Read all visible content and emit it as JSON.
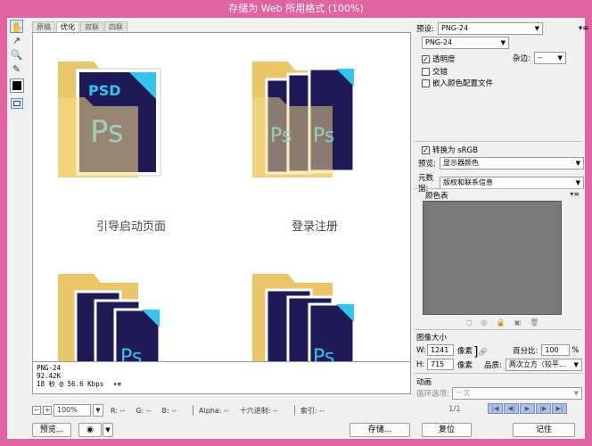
{
  "window": {
    "title": "存储为 Web 所用格式 (100%)"
  },
  "tabs": [
    {
      "label": "原稿"
    },
    {
      "label": "优化"
    },
    {
      "label": "双联"
    },
    {
      "label": "四联"
    }
  ],
  "canvas": {
    "captions": [
      "引导启动页面",
      "登录注册"
    ],
    "folder_badges": [
      "PSD",
      "Ps"
    ]
  },
  "info": {
    "format": "PNG-24",
    "size": "92.42K",
    "time": "18 秒 @ 56.6 Kbps",
    "menu_glyph": "▾≡"
  },
  "status": {
    "zoom": "100%",
    "r": "R: --",
    "g": "G: --",
    "b": "B: --",
    "alpha": "Alpha: --",
    "hex": "十六进制: --",
    "index": "索引: --"
  },
  "bottom_buttons": {
    "preview": "预览...",
    "save": "存储...",
    "reset": "复位",
    "remember": "记住"
  },
  "right": {
    "preset_label": "预设:",
    "preset_value": "PNG-24",
    "format_value": "PNG-24",
    "transparency": "透明度",
    "matte_label": "杂边:",
    "matte_value": "--",
    "interlaced": "交错",
    "embed_profile": "嵌入颜色配置文件",
    "convert_srgb": "转换为 sRGB",
    "preview_label": "预览:",
    "preview_value": "显示器颜色",
    "metadata_label": "元数据:",
    "metadata_value": "版权和联系信息",
    "color_table": "颜色表",
    "image_size": "图像大小",
    "w_label": "W:",
    "w_value": "1241",
    "h_label": "H:",
    "h_value": "715",
    "unit": "像素",
    "percent_label": "百分比:",
    "percent_value": "100",
    "percent_sign": "%",
    "quality_label": "品质:",
    "quality_value": "两次立方（较平...",
    "animation": "动画",
    "loop_label": "循环选项:",
    "loop_value": "一次",
    "frame": "1/1"
  },
  "colors": {
    "chrome": "#e2649f",
    "folder": "#f7dc8a",
    "ps_dark": "#1e1a56",
    "ps_blue": "#31c5f0"
  }
}
